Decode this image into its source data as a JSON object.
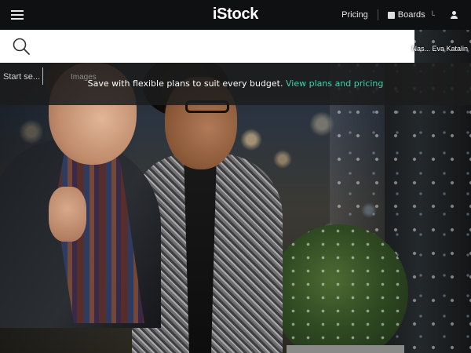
{
  "header": {
    "logo": "iStock",
    "nav": {
      "pricing_label": "Pricing",
      "boards_label": "Boards",
      "boards_caret": "└"
    }
  },
  "search": {
    "placeholder": "Start se...",
    "filter_label": "Images"
  },
  "hero": {
    "credit": "Nas... Eva Katalin"
  },
  "promo": {
    "text": "Save with flexible plans to suit every budget.",
    "link_label": "View plans and pricing",
    "link_color": "#3dd4a6"
  },
  "icons": [
    "menu-icon",
    "boards-icon",
    "user-icon",
    "search-icon"
  ]
}
